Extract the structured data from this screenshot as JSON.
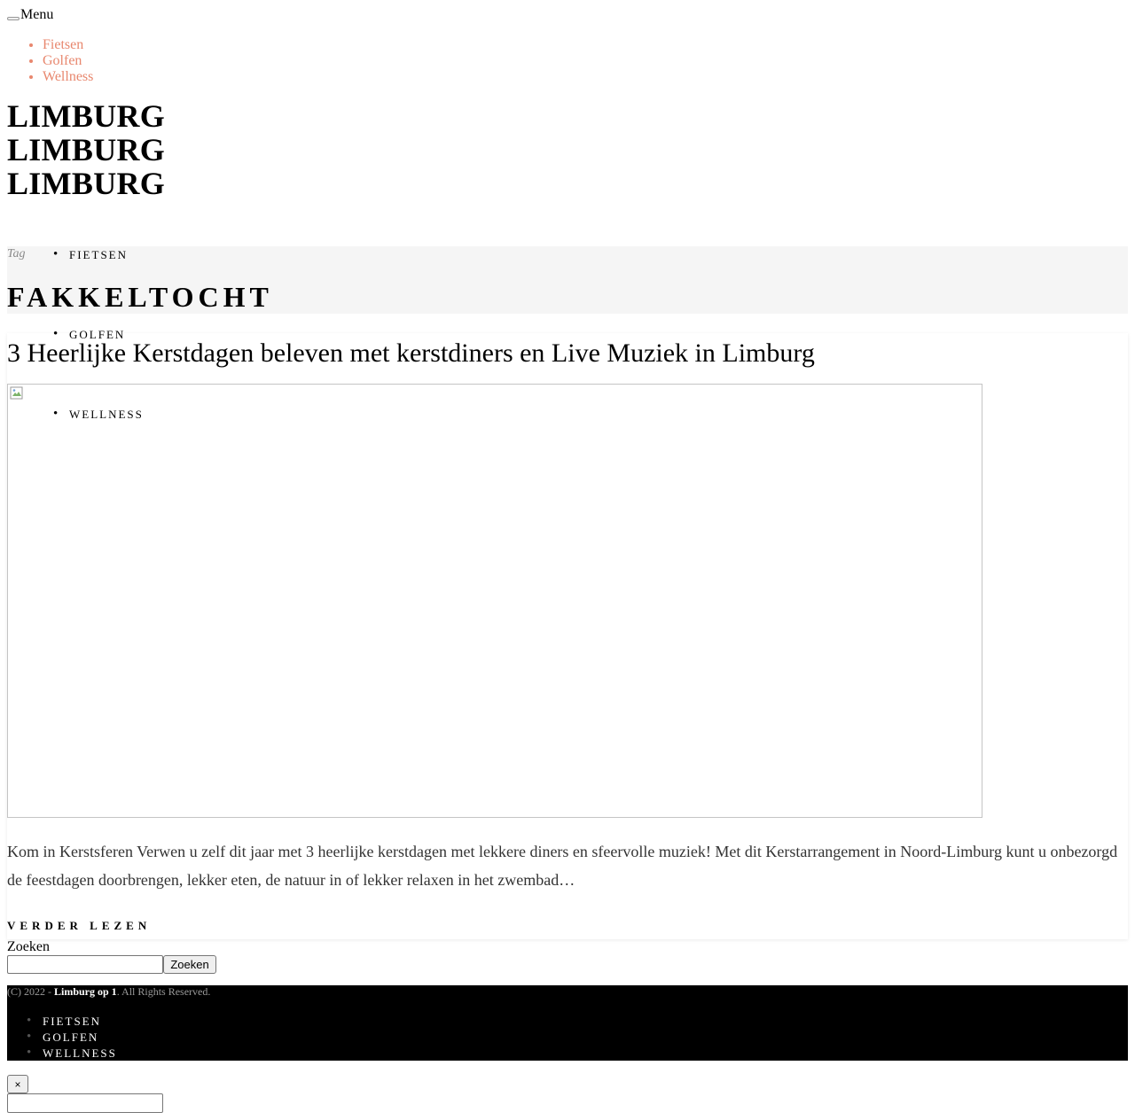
{
  "menu": {
    "label": "Menu"
  },
  "top_nav": [
    {
      "label": "Fietsen"
    },
    {
      "label": "Golfen"
    },
    {
      "label": "Wellness"
    }
  ],
  "brand": {
    "lines": [
      "LIMBURG",
      "LIMBURG",
      "LIMBURG"
    ]
  },
  "tag_header": {
    "label": "Tag",
    "title": "FAKKELTOCHT"
  },
  "categories": [
    {
      "label": "FIETSEN"
    },
    {
      "label": "GOLFEN"
    },
    {
      "label": "WELLNESS"
    }
  ],
  "post": {
    "title": "3 Heerlijke Kerstdagen beleven met kerstdiners en Live Muziek in Limburg",
    "excerpt": "Kom in Kerstsferen Verwen u zelf dit jaar met 3 heerlijke kerstdagen met lekkere diners en sfeervolle muziek! Met dit Kerstarrangement in Noord-Limburg kunt u onbezorgd de feestdagen doorbrengen, lekker eten, de natuur in of lekker relaxen in het zwembad…",
    "read_more": "VERDER LEZEN",
    "image_icon": "broken-image-icon"
  },
  "search": {
    "label": "Zoeken",
    "button": "Zoeken",
    "value": ""
  },
  "footer": {
    "copyright_prefix": "(C) 2022 - ",
    "site_name": "Limburg op 1",
    "copyright_suffix": ". All Rights Reserved.",
    "nav": [
      {
        "label": "FIETSEN"
      },
      {
        "label": "GOLFEN"
      },
      {
        "label": "WELLNESS"
      }
    ]
  },
  "overlay": {
    "close_label": "×",
    "input_value": ""
  },
  "colors": {
    "link": "#e8876e",
    "footer_bg": "#000000",
    "tag_band_bg": "#f5f5f5"
  }
}
